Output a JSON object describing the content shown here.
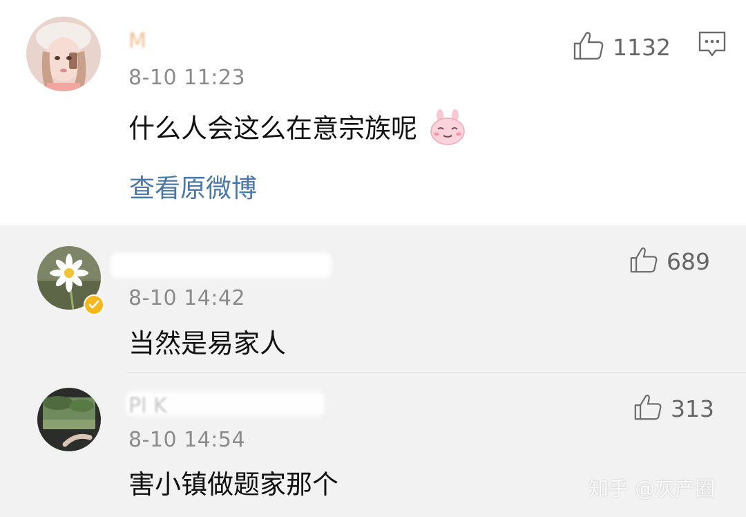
{
  "comments": [
    {
      "username": "M",
      "timestamp": "8-10 11:23",
      "text": "什么人会这么在意宗族呢",
      "emoji_icon": "bunny-smile-icon",
      "likes": "1132",
      "view_original": "查看原微博"
    },
    {
      "username": "",
      "timestamp": "8-10 14:42",
      "text": "当然是易家人",
      "likes": "689",
      "verified": true
    },
    {
      "username": "Pl                 K",
      "timestamp": "8-10 14:54",
      "text": "害小镇做题家那个",
      "likes": "313"
    }
  ],
  "watermark": "知乎 @灰产圈",
  "colors": {
    "link": "#4a78a8",
    "timestamp": "#8a8a8a",
    "reply_background": "#f2f2f2",
    "verified": "#f5b81c"
  }
}
